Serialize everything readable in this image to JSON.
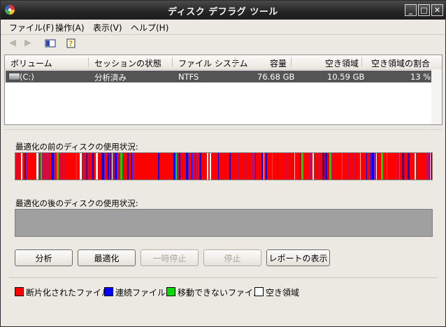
{
  "window": {
    "title": "ディスク デフラグ ツール"
  },
  "menu": [
    "ファイル(F)",
    "操作(A)",
    "表示(V)",
    "ヘルプ(H)"
  ],
  "toolbar": {
    "icons": [
      "back-arrow-icon",
      "forward-arrow-icon",
      "console-tree-icon",
      "help-icon"
    ]
  },
  "volumes": {
    "columns": [
      "ボリューム",
      "セッションの状態",
      "ファイル システム",
      "容量",
      "空き領域",
      "空き領域の割合"
    ],
    "rows": [
      {
        "volume": "(C:)",
        "status": "分析済み",
        "filesystem": "NTFS",
        "capacity": "76.68 GB",
        "free": "10.59 GB",
        "free_pct": "13 %"
      }
    ]
  },
  "analysis": {
    "before_label": "最適化の前のディスクの使用状況:",
    "after_label": "最適化の後のディスクの使用状況:"
  },
  "buttons": {
    "analyze": "分析",
    "defragment": "最適化",
    "pause": "一時停止",
    "stop": "停止",
    "report": "レポートの表示"
  },
  "legend": [
    {
      "label": "断片化されたファイル",
      "color": "#ff0000"
    },
    {
      "label": "連続ファイル",
      "color": "#0000ff"
    },
    {
      "label": "移動できないファイル",
      "color": "#00dd00"
    },
    {
      "label": "空き領域",
      "color": "#ffffff"
    }
  ],
  "colors": {
    "fragmented": "#ff0000",
    "contiguous": "#0000ff",
    "unmovable": "#00dd00",
    "free": "#ffffff",
    "selected_row": "#555555"
  }
}
